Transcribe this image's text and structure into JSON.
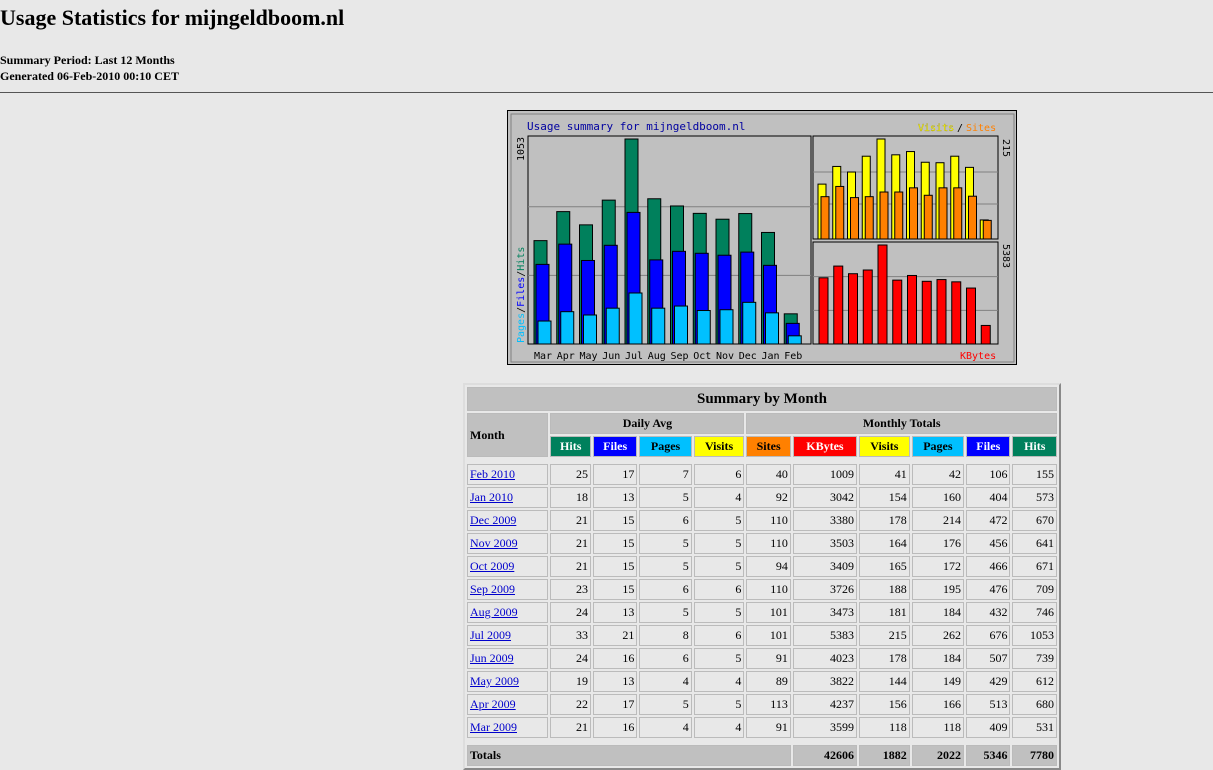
{
  "title": "Usage Statistics for mijngeldboom.nl",
  "period": "Summary Period: Last 12 Months",
  "generated": "Generated 06-Feb-2010 00:10 CET",
  "colors": {
    "hits": "#00805c",
    "files": "#0000ff",
    "pages": "#00c0ff",
    "visits": "#ffff00",
    "sites": "#ff8000",
    "kbytes": "#ff0000"
  },
  "chart_data": {
    "type": "bar",
    "title": "Usage summary for mijngeldboom.nl",
    "categories": [
      "Mar",
      "Apr",
      "May",
      "Jun",
      "Jul",
      "Aug",
      "Sep",
      "Oct",
      "Nov",
      "Dec",
      "Jan",
      "Feb"
    ],
    "left_axis_label": "Pages / Files / Hits",
    "left_max_label": "1053",
    "right_top_legend": [
      "Visits",
      "/",
      "Sites"
    ],
    "right_top_max_label": "215",
    "right_bottom_legend": "KBytes",
    "right_bottom_max_label": "5383",
    "series": [
      {
        "name": "Hits",
        "values": [
          531,
          680,
          612,
          739,
          1053,
          746,
          709,
          671,
          641,
          670,
          573,
          155
        ]
      },
      {
        "name": "Files",
        "values": [
          409,
          513,
          429,
          507,
          676,
          432,
          476,
          466,
          456,
          472,
          404,
          106
        ]
      },
      {
        "name": "Pages",
        "values": [
          118,
          166,
          149,
          184,
          262,
          184,
          195,
          172,
          176,
          214,
          160,
          42
        ]
      },
      {
        "name": "Visits",
        "values": [
          118,
          156,
          144,
          178,
          215,
          181,
          188,
          165,
          164,
          178,
          154,
          41
        ]
      },
      {
        "name": "Sites",
        "values": [
          91,
          113,
          89,
          91,
          101,
          101,
          110,
          94,
          110,
          110,
          92,
          40
        ]
      },
      {
        "name": "KBytes",
        "values": [
          3599,
          4237,
          3822,
          4023,
          5383,
          3473,
          3726,
          3409,
          3503,
          3380,
          3042,
          1009
        ]
      }
    ]
  },
  "table": {
    "caption": "Summary by Month",
    "month_header": "Month",
    "daily_avg_header": "Daily Avg",
    "monthly_totals_header": "Monthly Totals",
    "columns": [
      "Hits",
      "Files",
      "Pages",
      "Visits",
      "Sites",
      "KBytes",
      "Visits",
      "Pages",
      "Files",
      "Hits"
    ],
    "rows": [
      {
        "month": "Feb 2010",
        "cells": [
          "25",
          "17",
          "7",
          "6",
          "40",
          "1009",
          "41",
          "42",
          "106",
          "155"
        ]
      },
      {
        "month": "Jan 2010",
        "cells": [
          "18",
          "13",
          "5",
          "4",
          "92",
          "3042",
          "154",
          "160",
          "404",
          "573"
        ]
      },
      {
        "month": "Dec 2009",
        "cells": [
          "21",
          "15",
          "6",
          "5",
          "110",
          "3380",
          "178",
          "214",
          "472",
          "670"
        ]
      },
      {
        "month": "Nov 2009",
        "cells": [
          "21",
          "15",
          "5",
          "5",
          "110",
          "3503",
          "164",
          "176",
          "456",
          "641"
        ]
      },
      {
        "month": "Oct 2009",
        "cells": [
          "21",
          "15",
          "5",
          "5",
          "94",
          "3409",
          "165",
          "172",
          "466",
          "671"
        ]
      },
      {
        "month": "Sep 2009",
        "cells": [
          "23",
          "15",
          "6",
          "6",
          "110",
          "3726",
          "188",
          "195",
          "476",
          "709"
        ]
      },
      {
        "month": "Aug 2009",
        "cells": [
          "24",
          "13",
          "5",
          "5",
          "101",
          "3473",
          "181",
          "184",
          "432",
          "746"
        ]
      },
      {
        "month": "Jul 2009",
        "cells": [
          "33",
          "21",
          "8",
          "6",
          "101",
          "5383",
          "215",
          "262",
          "676",
          "1053"
        ]
      },
      {
        "month": "Jun 2009",
        "cells": [
          "24",
          "16",
          "6",
          "5",
          "91",
          "4023",
          "178",
          "184",
          "507",
          "739"
        ]
      },
      {
        "month": "May 2009",
        "cells": [
          "19",
          "13",
          "4",
          "4",
          "89",
          "3822",
          "144",
          "149",
          "429",
          "612"
        ]
      },
      {
        "month": "Apr 2009",
        "cells": [
          "22",
          "17",
          "5",
          "5",
          "113",
          "4237",
          "156",
          "166",
          "513",
          "680"
        ]
      },
      {
        "month": "Mar 2009",
        "cells": [
          "21",
          "16",
          "4",
          "4",
          "91",
          "3599",
          "118",
          "118",
          "409",
          "531"
        ]
      }
    ],
    "totals_label": "Totals",
    "totals": [
      "42606",
      "1882",
      "2022",
      "5346",
      "7780"
    ]
  }
}
